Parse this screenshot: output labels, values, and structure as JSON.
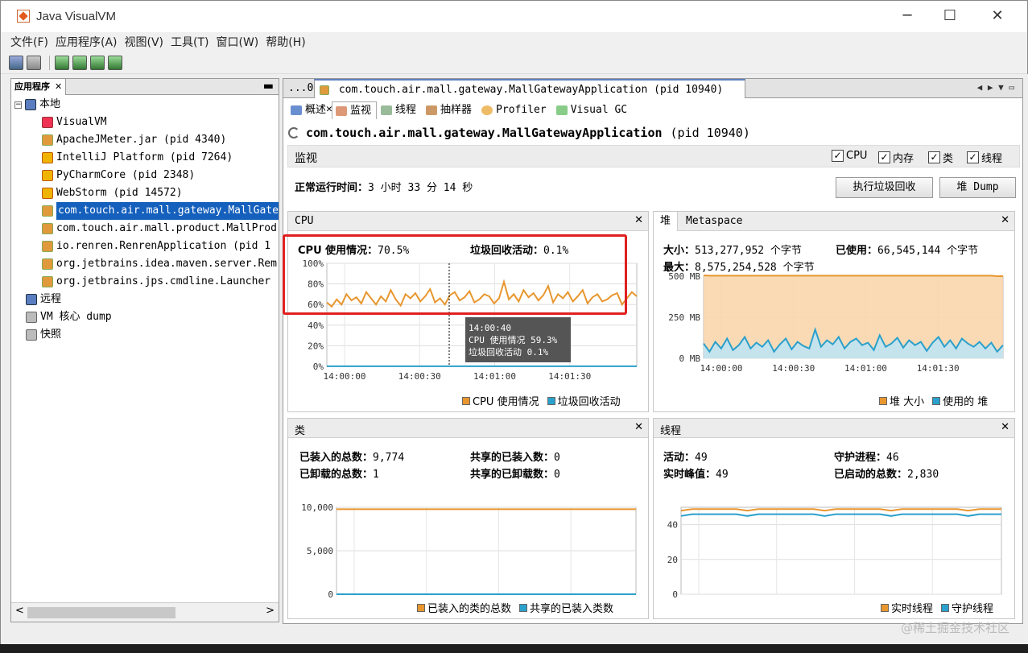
{
  "window": {
    "title": "Java VisualVM"
  },
  "menu": [
    "文件(F)",
    "应用程序(A)",
    "视图(V)",
    "工具(T)",
    "窗口(W)",
    "帮助(H)"
  ],
  "left_panel": {
    "tab": "应用程序",
    "tree": {
      "local": "本地",
      "local_items": [
        {
          "label": "VisualVM",
          "icon": "visualvm-icon"
        },
        {
          "label": "ApacheJMeter.jar  (pid 4340)",
          "icon": "java-icon"
        },
        {
          "label": "IntelliJ Platform  (pid 7264)",
          "icon": "jetbrains-icon"
        },
        {
          "label": "PyCharmCore  (pid 2348)",
          "icon": "jetbrains-icon"
        },
        {
          "label": "WebStorm  (pid 14572)",
          "icon": "jetbrains-icon"
        },
        {
          "label": "com.touch.air.mall.gateway.MallGate",
          "icon": "java-icon",
          "selected": true
        },
        {
          "label": "com.touch.air.mall.product.MallProd",
          "icon": "java-icon"
        },
        {
          "label": "io.renren.RenrenApplication  (pid 1",
          "icon": "java-icon"
        },
        {
          "label": "org.jetbrains.idea.maven.server.Rem",
          "icon": "java-icon"
        },
        {
          "label": "org.jetbrains.jps.cmdline.Launcher",
          "icon": "java-icon"
        }
      ],
      "remote": "远程",
      "vm_dump": "VM 核心 dump",
      "snapshot": "快照"
    }
  },
  "doc_tabs": {
    "prev": "...0)",
    "active": "com.touch.air.mall.gateway.MallGatewayApplication (pid 10940)"
  },
  "sub_tabs": [
    "概述",
    "监视",
    "线程",
    "抽样器",
    "Profiler",
    "Visual GC"
  ],
  "app_title": {
    "name": "com.touch.air.mall.gateway.MallGatewayApplication",
    "pid": "(pid 10940)"
  },
  "monitor": {
    "section": "监视",
    "checkboxes": [
      "CPU",
      "内存",
      "类",
      "线程"
    ],
    "uptime_label": "正常运行时间：",
    "uptime_value": "3 小时 33 分 14 秒",
    "gc_button": "执行垃圾回收",
    "dump_button": "堆 Dump"
  },
  "cpu_panel": {
    "title": "CPU",
    "usage_label": "CPU 使用情况：",
    "usage_value": "70.5%",
    "gc_label": "垃圾回收活动：",
    "gc_value": "0.1%",
    "legend": [
      "CPU 使用情况",
      "垃圾回收活动"
    ],
    "tooltip": {
      "time": "14:00:40",
      "cpu": "CPU 使用情况  59.3%",
      "gc": "垃圾回收活动   0.1%"
    }
  },
  "heap_panel": {
    "tab_heap": "堆",
    "tab_meta": "Metaspace",
    "size_label": "大小：",
    "size_value": "513,277,952 个字节",
    "used_label": "已使用：",
    "used_value": "66,545,144 个字节",
    "max_label": "最大：",
    "max_value": "8,575,254,528 个字节",
    "legend": [
      "堆 大小",
      "使用的 堆"
    ]
  },
  "classes_panel": {
    "title": "类",
    "loaded_label": "已装入的总数：",
    "loaded_value": "9,774",
    "shared_loaded_label": "共享的已装入数：",
    "shared_loaded_value": "0",
    "unloaded_label": "已卸载的总数：",
    "unloaded_value": "1",
    "shared_unloaded_label": "共享的已卸载数：",
    "shared_unloaded_value": "0",
    "legend": [
      "已装入的类的总数",
      "共享的已装入类数"
    ]
  },
  "threads_panel": {
    "title": "线程",
    "live_label": "活动：",
    "live_value": "49",
    "daemon_label": "守护进程：",
    "daemon_value": "46",
    "peak_label": "实时峰值：",
    "peak_value": "49",
    "started_label": "已启动的总数：",
    "started_value": "2,830",
    "legend": [
      "实时线程",
      "守护线程"
    ]
  },
  "watermark": "@稀土掘金技术社区",
  "colors": {
    "orange": "#e8962e",
    "blue": "#2aa0cc",
    "selection": "#1560bd",
    "highlight": "#e02020"
  },
  "chart_data": [
    {
      "type": "line",
      "title": "CPU",
      "x_ticks": [
        "14:00:00",
        "14:00:30",
        "14:01:00",
        "14:01:30"
      ],
      "y_ticks": [
        "0%",
        "20%",
        "40%",
        "60%",
        "80%",
        "100%"
      ],
      "ylim": [
        0,
        100
      ],
      "series": [
        {
          "name": "CPU 使用情况",
          "values": [
            62,
            58,
            65,
            60,
            70,
            64,
            67,
            61,
            72,
            66,
            60,
            68,
            63,
            74,
            65,
            59,
            70,
            66,
            71,
            63,
            68,
            75,
            62,
            66,
            60,
            69,
            72,
            64,
            67,
            73,
            62,
            65,
            70,
            68,
            61,
            66,
            82,
            65,
            70,
            63,
            74,
            67,
            71,
            64,
            69,
            78,
            62,
            70,
            66,
            72,
            63,
            68,
            74,
            61,
            67,
            70,
            63,
            65,
            69,
            71,
            60,
            66,
            72,
            68
          ]
        },
        {
          "name": "垃圾回收活动",
          "values": [
            0.1,
            0.1,
            0.1,
            0.1,
            0.1,
            0.1,
            0.1,
            0.1,
            0.1,
            0.1,
            0.1,
            0.1,
            0.1,
            0.1,
            0.1,
            0.1,
            0.1,
            0.1,
            0.1,
            0.1,
            0.1,
            0.1,
            0.1,
            0.1,
            0.1,
            0.1,
            0.1,
            0.1,
            0.1,
            0.1,
            0.1,
            0.1,
            0.1,
            0.1,
            0.1,
            0.1,
            0.1,
            0.1,
            0.1,
            0.1,
            0.1,
            0.1,
            0.1,
            0.1,
            0.1,
            0.1,
            0.1,
            0.1,
            0.1,
            0.1,
            0.1,
            0.1,
            0.1,
            0.1,
            0.1,
            0.1,
            0.1,
            0.1,
            0.1,
            0.1,
            0.1,
            0.1,
            0.1,
            0.1
          ]
        }
      ]
    },
    {
      "type": "area",
      "title": "堆",
      "x_ticks": [
        "14:00:00",
        "14:00:30",
        "14:01:00",
        "14:01:30"
      ],
      "y_ticks": [
        "0 MB",
        "250 MB",
        "500 MB"
      ],
      "ylim": [
        0,
        500
      ],
      "series": [
        {
          "name": "堆 大小",
          "values": [
            505,
            503,
            503,
            503,
            503,
            503,
            503,
            503,
            503,
            503,
            503,
            503,
            503,
            503,
            503,
            503,
            503,
            503,
            503,
            503,
            503,
            503,
            503,
            503,
            503,
            503,
            503,
            503,
            503,
            503,
            503,
            503,
            503,
            503,
            503,
            503,
            503,
            503,
            503,
            503,
            503,
            503,
            503,
            503,
            503,
            503,
            503,
            503,
            503,
            503,
            500,
            500
          ]
        },
        {
          "name": "使用的 堆",
          "values": [
            90,
            40,
            100,
            60,
            120,
            50,
            80,
            130,
            60,
            95,
            70,
            110,
            40,
            85,
            120,
            55,
            100,
            75,
            60,
            175,
            70,
            110,
            85,
            130,
            60,
            100,
            120,
            80,
            95,
            50,
            140,
            70,
            90,
            125,
            65,
            110,
            80,
            100,
            45,
            95,
            130,
            70,
            110,
            60,
            120,
            90,
            70,
            100,
            60,
            95,
            40,
            80
          ]
        }
      ]
    },
    {
      "type": "line",
      "title": "类",
      "x_ticks": [
        "14:00:00",
        "14:00:30",
        "14:01:00",
        "14:01:30"
      ],
      "y_ticks": [
        "0",
        "5,000",
        "10,000"
      ],
      "ylim": [
        0,
        10000
      ],
      "series": [
        {
          "name": "已装入的类的总数",
          "values": [
            9774,
            9774
          ]
        },
        {
          "name": "共享的已装入类数",
          "values": [
            0,
            0
          ]
        }
      ]
    },
    {
      "type": "line",
      "title": "线程",
      "x_ticks": [
        "14:00:00",
        "14:00:30",
        "14:01:00",
        "14:01:30"
      ],
      "y_ticks": [
        "0",
        "20",
        "40"
      ],
      "ylim": [
        0,
        50
      ],
      "series": [
        {
          "name": "实时线程",
          "values": [
            48,
            49,
            49,
            49,
            49,
            49,
            48,
            49,
            49,
            49,
            49,
            49,
            49,
            48,
            49,
            49,
            49,
            49,
            49,
            48,
            49,
            49,
            49,
            49,
            49,
            49,
            48,
            49,
            49,
            49
          ]
        },
        {
          "name": "守护线程",
          "values": [
            45,
            46,
            46,
            46,
            46,
            46,
            45,
            46,
            46,
            46,
            46,
            46,
            46,
            45,
            46,
            46,
            46,
            46,
            46,
            45,
            46,
            46,
            46,
            46,
            46,
            46,
            45,
            46,
            46,
            46
          ]
        }
      ]
    }
  ]
}
